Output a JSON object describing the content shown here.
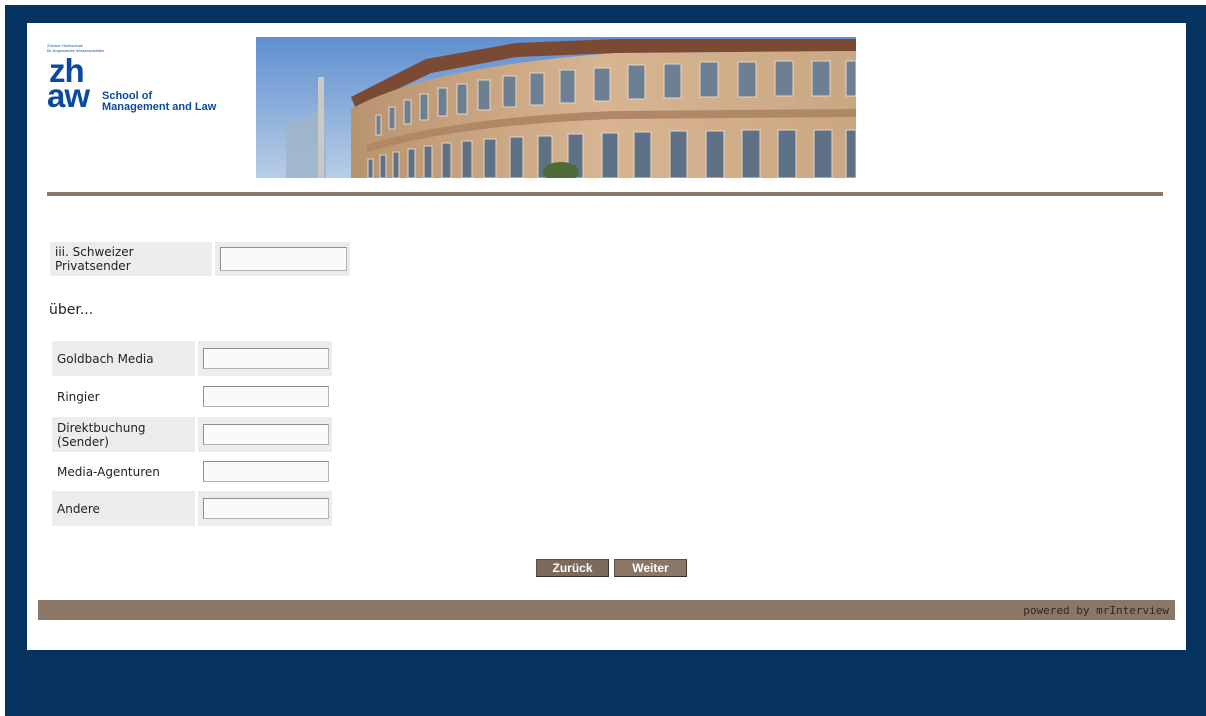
{
  "header": {
    "logo_small_text": [
      "Zürcher Hochschule",
      "für Angewandte Wissenschaften"
    ],
    "logo_zh": "zh",
    "logo_aw": "aw",
    "logo_school_line1": "School of",
    "logo_school_line2": "Management and Law"
  },
  "question_top": {
    "label": "iii. Schweizer Privatsender",
    "value": ""
  },
  "subheading": "über...",
  "rows": [
    {
      "label": "Goldbach Media",
      "value": ""
    },
    {
      "label": "Ringier",
      "value": ""
    },
    {
      "label": "Direktbuchung (Sender)",
      "value": ""
    },
    {
      "label": "Media-Agenturen",
      "value": ""
    },
    {
      "label": "Andere",
      "value": ""
    }
  ],
  "buttons": {
    "back": "Zurück",
    "next": "Weiter"
  },
  "footer": {
    "powered": "powered by mrInterview"
  },
  "colors": {
    "frame": "#06325f",
    "accent": "#8c7766",
    "logo": "#0a4a9f"
  }
}
